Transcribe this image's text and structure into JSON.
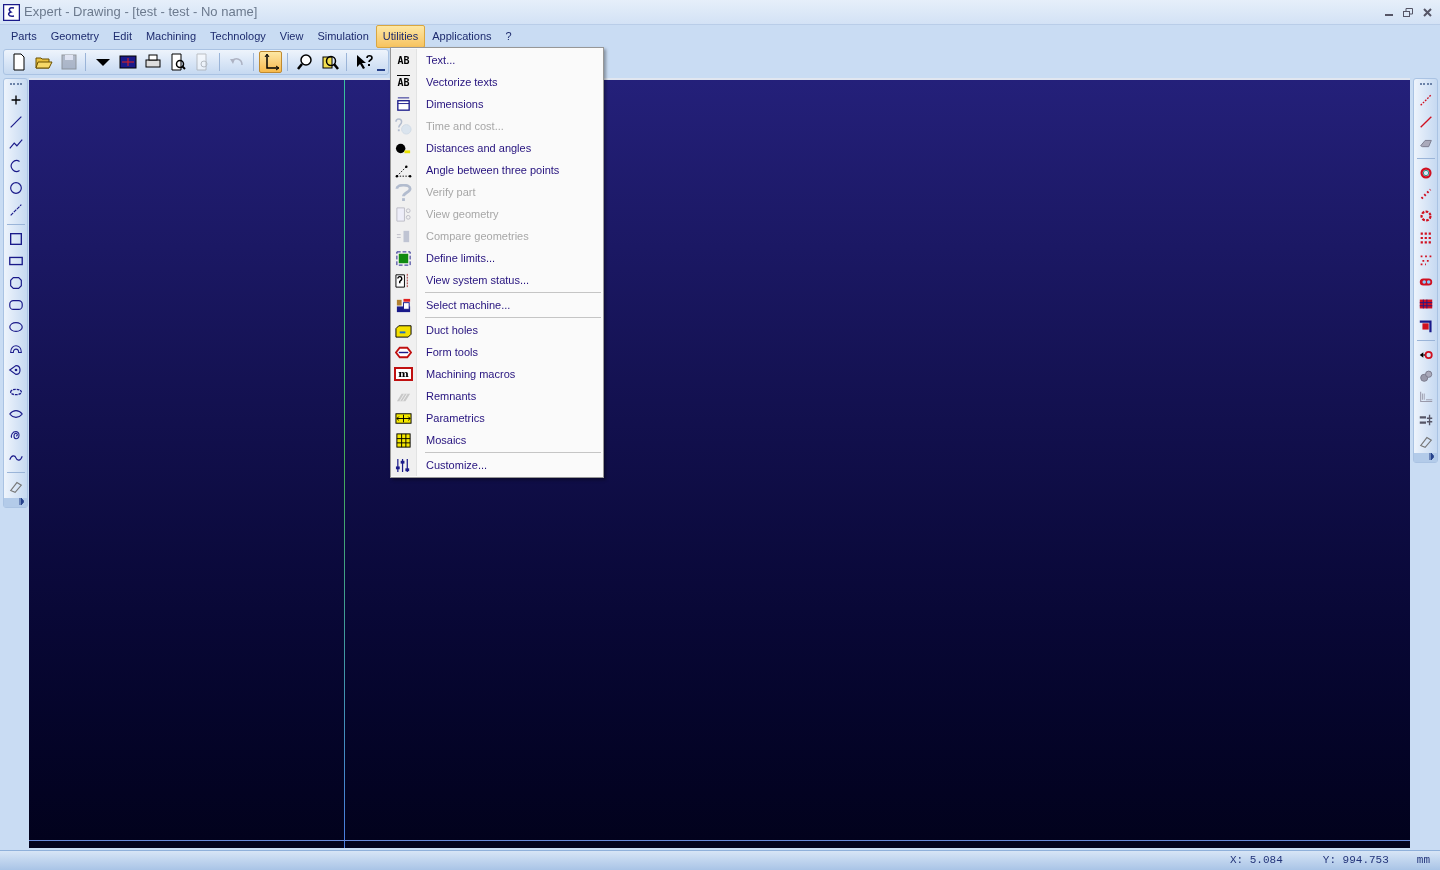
{
  "window": {
    "title": "Expert  - Drawing - [test - test - No name]"
  },
  "menu_bar": [
    {
      "label": "Parts",
      "selected": false
    },
    {
      "label": "Geometry",
      "selected": false
    },
    {
      "label": "Edit",
      "selected": false
    },
    {
      "label": "Machining",
      "selected": false
    },
    {
      "label": "Technology",
      "selected": false
    },
    {
      "label": "View",
      "selected": false
    },
    {
      "label": "Simulation",
      "selected": false
    },
    {
      "label": "Utilities",
      "selected": true
    },
    {
      "label": "Applications",
      "selected": false
    },
    {
      "label": "?",
      "selected": false
    }
  ],
  "toolbar": [
    {
      "kind": "new",
      "pressed": false,
      "disabled": false
    },
    {
      "kind": "open",
      "pressed": false,
      "disabled": false
    },
    {
      "kind": "save",
      "pressed": false,
      "disabled": true
    },
    {
      "kind": "sep"
    },
    {
      "kind": "dropdown",
      "pressed": false,
      "disabled": false
    },
    {
      "kind": "screen",
      "pressed": false,
      "disabled": false
    },
    {
      "kind": "print",
      "pressed": false,
      "disabled": false
    },
    {
      "kind": "preview",
      "pressed": false,
      "disabled": false
    },
    {
      "kind": "setup",
      "pressed": false,
      "disabled": true
    },
    {
      "kind": "sep"
    },
    {
      "kind": "undo",
      "pressed": false,
      "disabled": true
    },
    {
      "kind": "sep"
    },
    {
      "kind": "axes",
      "pressed": true,
      "disabled": false
    },
    {
      "kind": "sep"
    },
    {
      "kind": "zoom",
      "pressed": false,
      "disabled": false
    },
    {
      "kind": "zoomwin",
      "pressed": false,
      "disabled": false
    },
    {
      "kind": "sep"
    },
    {
      "kind": "help",
      "pressed": false,
      "disabled": false
    }
  ],
  "utilities_menu": [
    {
      "label": "Text...",
      "disabled": false,
      "separator_before": false,
      "icon_text": "AB"
    },
    {
      "label": "Vectorize texts",
      "disabled": false,
      "separator_before": false,
      "icon_text": "AB"
    },
    {
      "label": "Dimensions",
      "disabled": false,
      "separator_before": false
    },
    {
      "label": "Time and cost...",
      "disabled": true,
      "separator_before": false
    },
    {
      "label": "Distances and angles",
      "disabled": false,
      "separator_before": false
    },
    {
      "label": "Angle between three points",
      "disabled": false,
      "separator_before": false
    },
    {
      "label": "Verify part",
      "disabled": true,
      "separator_before": false
    },
    {
      "label": "View geometry",
      "disabled": true,
      "separator_before": false
    },
    {
      "label": "Compare geometries",
      "disabled": true,
      "separator_before": false
    },
    {
      "label": "Define limits...",
      "disabled": false,
      "separator_before": false
    },
    {
      "label": "View system status...",
      "disabled": false,
      "separator_before": false
    },
    {
      "label": "Select machine...",
      "disabled": false,
      "separator_before": true
    },
    {
      "label": "Duct holes",
      "disabled": false,
      "separator_before": true
    },
    {
      "label": "Form tools",
      "disabled": false,
      "separator_before": false
    },
    {
      "label": "Machining macros",
      "disabled": false,
      "separator_before": false,
      "icon_text": "m"
    },
    {
      "label": "Remnants",
      "disabled": false,
      "separator_before": false
    },
    {
      "label": "Parametrics",
      "disabled": false,
      "separator_before": false
    },
    {
      "label": "Mosaics",
      "disabled": false,
      "separator_before": false
    },
    {
      "label": "Customize...",
      "disabled": false,
      "separator_before": true
    }
  ],
  "status_bar": {
    "x": "X: 5.084",
    "y": "Y: 994.753",
    "unit": "mm"
  }
}
